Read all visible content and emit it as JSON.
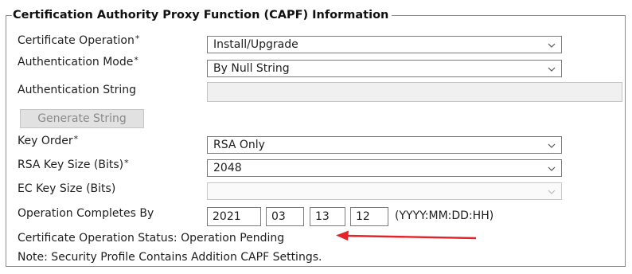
{
  "section": {
    "title": "Certification Authority Proxy Function (CAPF) Information"
  },
  "fields": {
    "cert_operation": {
      "label": "Certificate Operation",
      "required_mark": "*",
      "value": "Install/Upgrade"
    },
    "auth_mode": {
      "label": "Authentication Mode",
      "required_mark": "*",
      "value": "By Null String"
    },
    "auth_string": {
      "label": "Authentication String",
      "value": ""
    },
    "generate_button": {
      "label": "Generate String"
    },
    "key_order": {
      "label": "Key Order",
      "required_mark": "*",
      "value": "RSA Only"
    },
    "rsa_key_size": {
      "label": "RSA Key Size (Bits)",
      "required_mark": "*",
      "value": "2048"
    },
    "ec_key_size": {
      "label": "EC Key Size (Bits)",
      "value": ""
    },
    "operation_completes": {
      "label": "Operation Completes By",
      "year": "2021",
      "month": "03",
      "day": "13",
      "hour": "12",
      "format_hint": "(YYYY:MM:DD:HH)"
    }
  },
  "status": {
    "label": "Certificate Operation Status:",
    "value": "Operation Pending"
  },
  "note": "Note: Security Profile Contains Addition CAPF Settings.",
  "colors": {
    "annotation_arrow": "#e3242b",
    "border": "#8c8c8c"
  },
  "icons": {
    "dropdown": "chevron-down-icon",
    "annotation": "arrow-left-icon"
  }
}
